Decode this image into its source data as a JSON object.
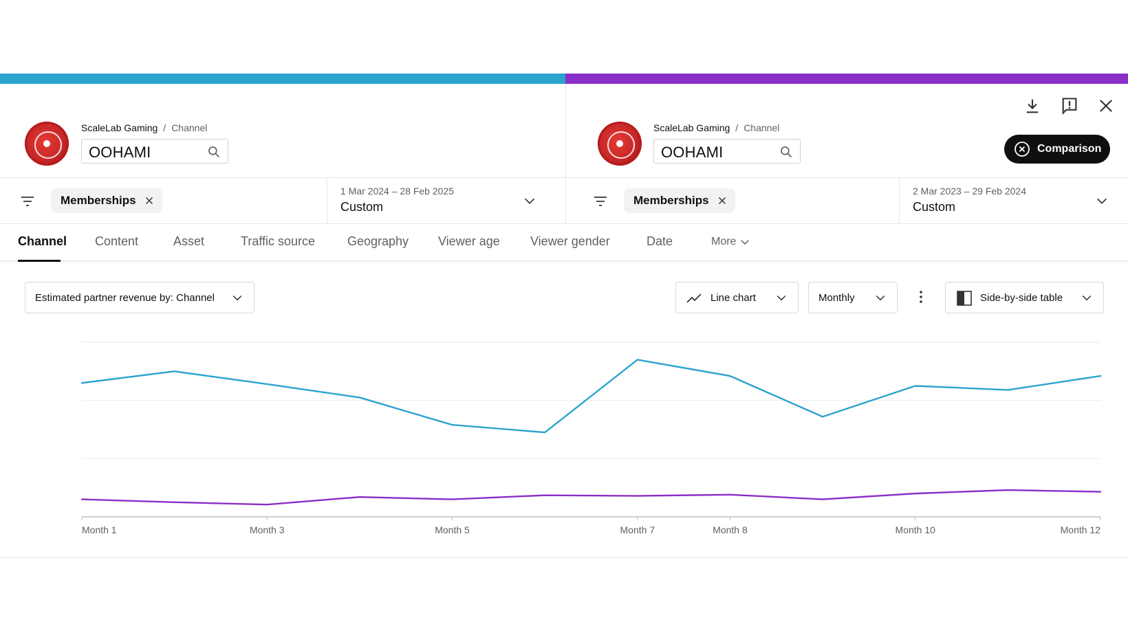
{
  "colors": {
    "primary_period": "#2aa3cf",
    "comparison_period": "#8a2ec7"
  },
  "left_panel": {
    "breadcrumb": {
      "first": "ScaleLab Gaming",
      "separator": "/",
      "second": "Channel"
    },
    "search_value": "OOHAMI",
    "filter_chip": "Memberships",
    "date_range": "1 Mar 2024 – 28 Feb 2025",
    "date_preset": "Custom"
  },
  "right_panel": {
    "breadcrumb": {
      "first": "ScaleLab Gaming",
      "separator": "/",
      "second": "Channel"
    },
    "search_value": "OOHAMI",
    "filter_chip": "Memberships",
    "date_range": "2 Mar 2023 – 29 Feb 2024",
    "date_preset": "Custom"
  },
  "header_icons": [
    "download-icon",
    "feedback-icon",
    "close-icon"
  ],
  "comparison_button": "Comparison",
  "tabs": [
    {
      "label": "Channel",
      "active": true
    },
    {
      "label": "Content"
    },
    {
      "label": "Asset"
    },
    {
      "label": "Traffic source"
    },
    {
      "label": "Geography"
    },
    {
      "label": "Viewer age"
    },
    {
      "label": "Viewer gender"
    },
    {
      "label": "Date"
    },
    {
      "label": "More"
    }
  ],
  "controls": {
    "metric_select": "Estimated partner revenue by: Channel",
    "chart_type": "Line chart",
    "interval": "Monthly",
    "view_mode": "Side-by-side table"
  },
  "chart_data": {
    "type": "line",
    "x": [
      1,
      2,
      3,
      4,
      5,
      6,
      7,
      8,
      9,
      10,
      11,
      12
    ],
    "tick_labels": [
      "Month 1",
      "Month 3",
      "Month 5",
      "Month 7",
      "Month 8",
      "Month 10",
      "Month 12"
    ],
    "tick_positions": [
      1,
      3,
      5,
      7,
      8,
      10,
      12
    ],
    "series": [
      {
        "color": "#2aa3cf",
        "values": [
          2.3,
          2.5,
          2.28,
          2.05,
          1.58,
          1.45,
          2.7,
          2.42,
          1.72,
          2.25,
          2.18,
          2.42
        ]
      },
      {
        "color": "#8a2ec7",
        "values": [
          0.3,
          0.25,
          0.21,
          0.34,
          0.3,
          0.37,
          0.36,
          0.38,
          0.3,
          0.4,
          0.46,
          0.43
        ]
      }
    ],
    "ylim": [
      0,
      3
    ],
    "grid": true
  }
}
